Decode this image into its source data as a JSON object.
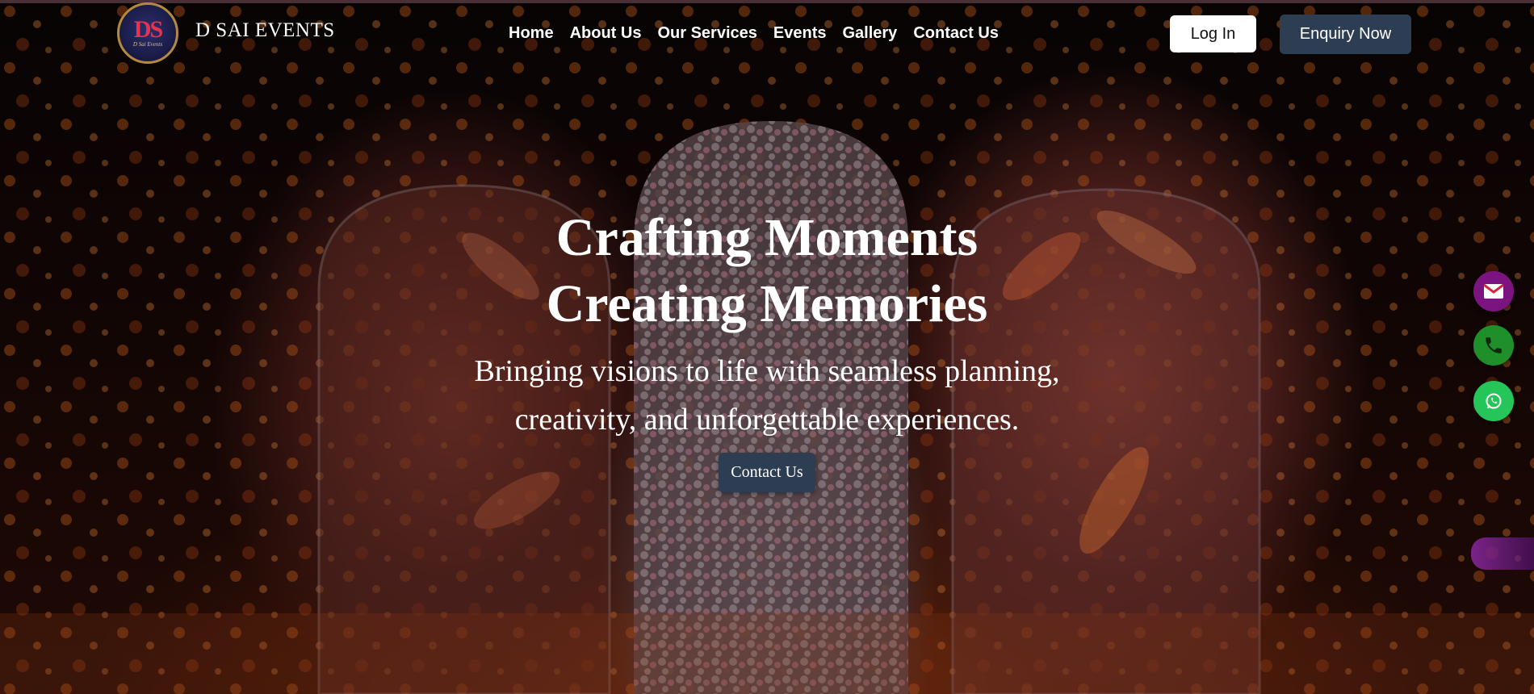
{
  "brand": {
    "name": "D SAI EVENTS",
    "logo_text": "DS",
    "logo_tagline": "D Sai Events"
  },
  "nav": {
    "items": [
      "Home",
      "About Us",
      "Our Services",
      "Events",
      "Gallery",
      "Contact Us"
    ]
  },
  "header": {
    "login_label": "Log In",
    "enquiry_label": "Enquiry Now"
  },
  "hero": {
    "title_line1": "Crafting Moments",
    "title_line2": "Creating Memories",
    "subtitle_line1": "Bringing visions to life with seamless planning,",
    "subtitle_line2": "creativity, and unforgettable experiences.",
    "cta_label": "Contact Us"
  },
  "floating_actions": [
    {
      "icon": "mail-icon",
      "color": "#7b1480"
    },
    {
      "icon": "phone-icon",
      "color": "#1f8f2a"
    },
    {
      "icon": "whatsapp-icon",
      "color": "#25c55a"
    }
  ],
  "colors": {
    "accent_button": "#2d3e52",
    "brand_red": "#e8334f",
    "logo_gold": "#b48a3c"
  }
}
